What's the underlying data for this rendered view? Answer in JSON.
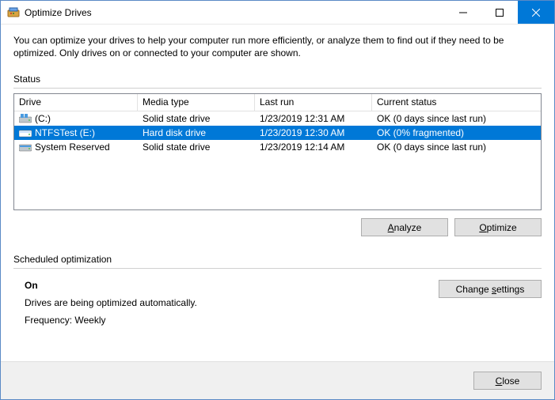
{
  "window": {
    "title": "Optimize Drives",
    "intro": "You can optimize your drives to help your computer run more efficiently, or analyze them to find out if they need to be optimized. Only drives on or connected to your computer are shown."
  },
  "status": {
    "label": "Status",
    "columns": {
      "drive": "Drive",
      "media": "Media type",
      "last": "Last run",
      "current": "Current status"
    },
    "rows": [
      {
        "name": "(C:)",
        "icon": "ssd",
        "media": "Solid state drive",
        "last": "1/23/2019 12:31 AM",
        "status": "OK (0 days since last run)",
        "selected": false
      },
      {
        "name": "NTFSTest (E:)",
        "icon": "hdd",
        "media": "Hard disk drive",
        "last": "1/23/2019 12:30 AM",
        "status": "OK (0% fragmented)",
        "selected": true
      },
      {
        "name": "System Reserved",
        "icon": "hdd",
        "media": "Solid state drive",
        "last": "1/23/2019 12:14 AM",
        "status": "OK (0 days since last run)",
        "selected": false
      }
    ]
  },
  "buttons": {
    "analyze_pre": "",
    "analyze_key": "A",
    "analyze_post": "nalyze",
    "optimize_pre": "",
    "optimize_key": "O",
    "optimize_post": "ptimize",
    "change_pre": "Change ",
    "change_key": "s",
    "change_post": "ettings",
    "close_pre": "",
    "close_key": "C",
    "close_post": "lose"
  },
  "scheduled": {
    "label": "Scheduled optimization",
    "state": "On",
    "desc": "Drives are being optimized automatically.",
    "freq": "Frequency: Weekly"
  }
}
